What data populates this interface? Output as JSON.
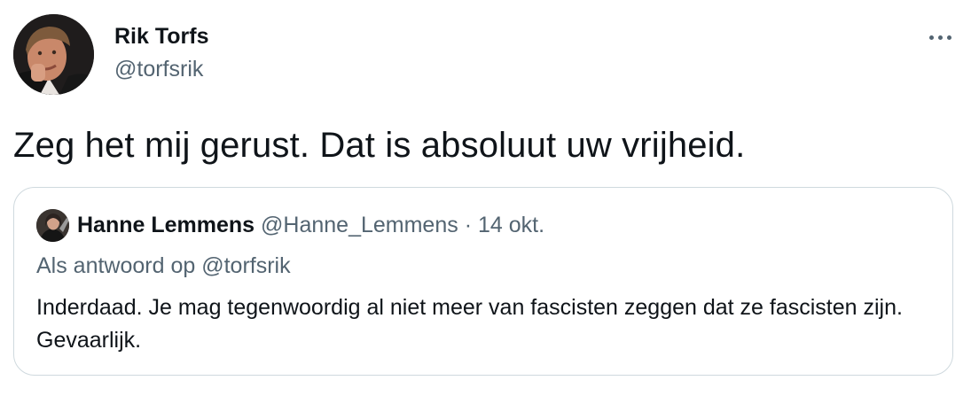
{
  "author": {
    "name": "Rik Torfs",
    "handle": "@torfsrik"
  },
  "more_options_icon": "ellipsis-horizontal-icon",
  "tweet_text": "Zeg het mij gerust. Dat is absoluut uw vrijheid.",
  "quoted_tweet": {
    "author_name": "Hanne Lemmens",
    "author_handle": "@Hanne_Lemmens",
    "separator": "·",
    "date": "14 okt.",
    "reply_prefix": "Als antwoord op",
    "reply_to": "@torfsrik",
    "text": "Inderdaad. Je mag tegenwoordig al niet meer van fascisten zeggen dat ze fascisten zijn. Gevaarlijk."
  },
  "colors": {
    "text": "#0f1419",
    "secondary": "#536471",
    "border": "#cfd9de"
  }
}
